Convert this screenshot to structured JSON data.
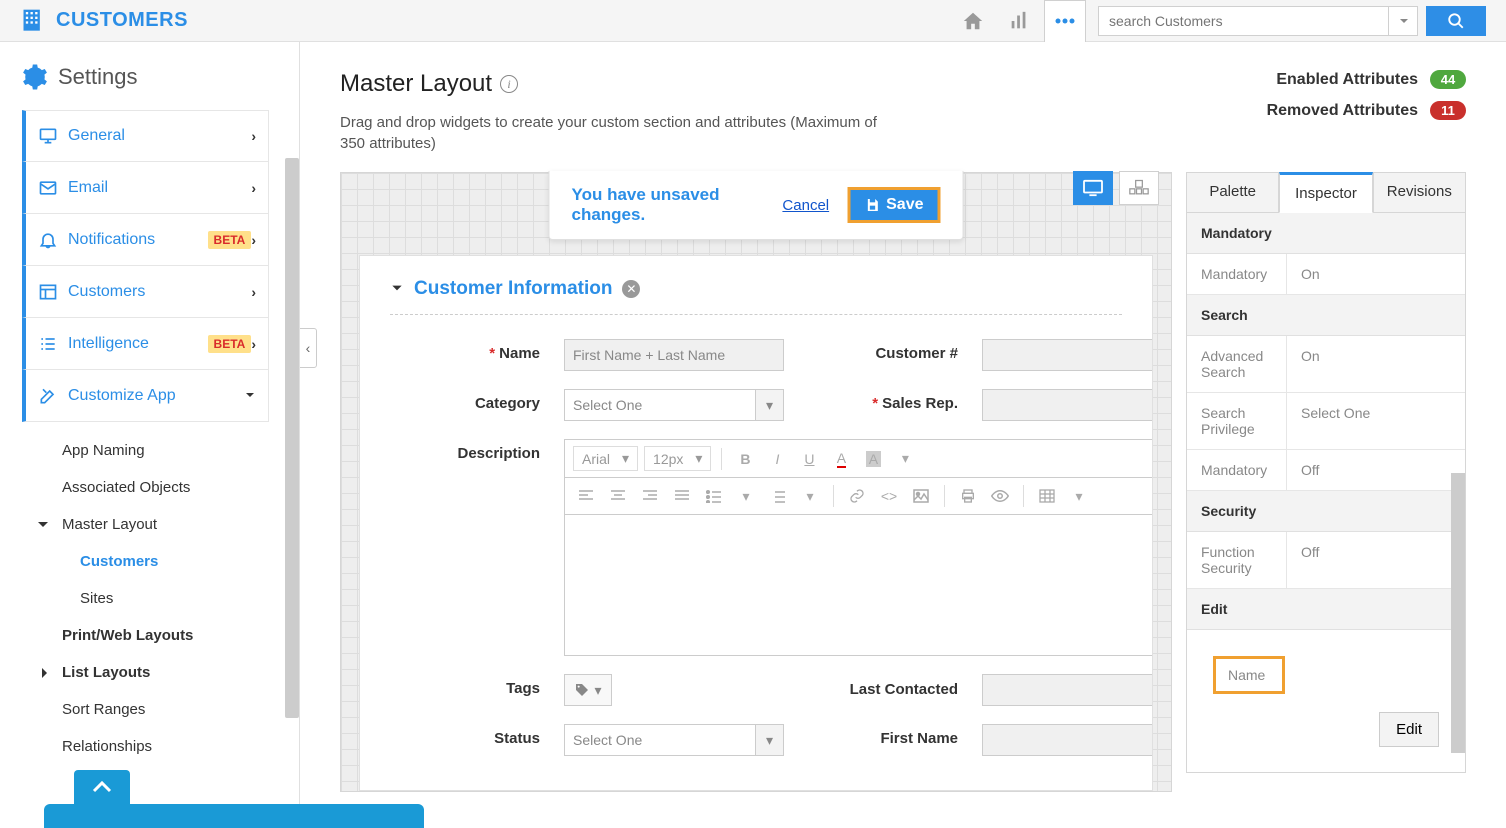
{
  "app": {
    "name": "CUSTOMERS",
    "search_placeholder": "search Customers"
  },
  "settings_header": "Settings",
  "nav": [
    {
      "label": "General",
      "beta": false
    },
    {
      "label": "Email",
      "beta": false
    },
    {
      "label": "Notifications",
      "beta": true
    },
    {
      "label": "Customers",
      "beta": false
    },
    {
      "label": "Intelligence",
      "beta": true
    },
    {
      "label": "Customize App",
      "beta": false
    }
  ],
  "subnav": {
    "app_naming": "App Naming",
    "associated_objects": "Associated Objects",
    "master_layout": "Master Layout",
    "customers": "Customers",
    "sites": "Sites",
    "print_web": "Print/Web Layouts",
    "list_layouts": "List Layouts",
    "sort_ranges": "Sort Ranges",
    "relationships": "Relationships"
  },
  "page": {
    "title": "Master Layout",
    "subtitle": "Drag and drop widgets to create your custom section and attributes (Maximum of 350 attributes)"
  },
  "attrs": {
    "enabled_label": "Enabled Attributes",
    "enabled_count": "44",
    "removed_label": "Removed Attributes",
    "removed_count": "11"
  },
  "unsaved": {
    "message": "You have unsaved changes.",
    "cancel": "Cancel",
    "save": "Save"
  },
  "section": {
    "title": "Customer Information",
    "fields": {
      "name": "Name",
      "name_placeholder": "First Name +  Last Name",
      "customer_no": "Customer #",
      "category": "Category",
      "category_placeholder": "Select One",
      "sales_rep": "Sales Rep.",
      "description": "Description",
      "tags": "Tags",
      "last_contacted": "Last Contacted",
      "status": "Status",
      "status_placeholder": "Select One",
      "first_name": "First Name"
    },
    "rte": {
      "font": "Arial",
      "size": "12px"
    }
  },
  "tabs": {
    "palette": "Palette",
    "inspector": "Inspector",
    "revisions": "Revisions"
  },
  "inspector": {
    "mandatory_head": "Mandatory",
    "mandatory": {
      "label": "Mandatory",
      "value": "On"
    },
    "search_head": "Search",
    "adv_search": {
      "label": "Advanced Search",
      "value": "On"
    },
    "search_priv": {
      "label": "Search Privilege",
      "value": "Select One"
    },
    "search_mandatory": {
      "label": "Mandatory",
      "value": "Off"
    },
    "security_head": "Security",
    "func_sec": {
      "label": "Function Security",
      "value": "Off"
    },
    "edit_head": "Edit",
    "edit_field": "Name",
    "edit_btn": "Edit"
  },
  "beta_text": "BETA"
}
